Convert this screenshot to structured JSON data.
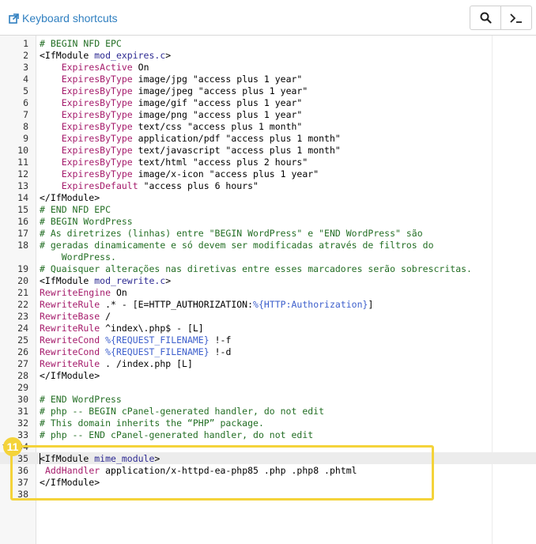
{
  "toolbar": {
    "shortcuts_label": "Keyboard shortcuts",
    "search_icon": "search-icon",
    "terminal_icon": "terminal-icon"
  },
  "editor": {
    "lines": [
      {
        "n": "1",
        "segs": [
          {
            "t": "# BEGIN NFD EPC",
            "c": "com"
          }
        ]
      },
      {
        "n": "2",
        "segs": [
          {
            "t": "<IfModule ",
            "c": ""
          },
          {
            "t": "mod_expires.c",
            "c": "tag"
          },
          {
            "t": ">",
            "c": ""
          }
        ]
      },
      {
        "n": "3",
        "segs": [
          {
            "t": "    ",
            "c": ""
          },
          {
            "t": "ExpiresActive",
            "c": "kw"
          },
          {
            "t": " On",
            "c": ""
          }
        ]
      },
      {
        "n": "4",
        "segs": [
          {
            "t": "    ",
            "c": ""
          },
          {
            "t": "ExpiresByType",
            "c": "kw"
          },
          {
            "t": " image/jpg \"access plus 1 year\"",
            "c": ""
          }
        ]
      },
      {
        "n": "5",
        "segs": [
          {
            "t": "    ",
            "c": ""
          },
          {
            "t": "ExpiresByType",
            "c": "kw"
          },
          {
            "t": " image/jpeg \"access plus 1 year\"",
            "c": ""
          }
        ]
      },
      {
        "n": "6",
        "segs": [
          {
            "t": "    ",
            "c": ""
          },
          {
            "t": "ExpiresByType",
            "c": "kw"
          },
          {
            "t": " image/gif \"access plus 1 year\"",
            "c": ""
          }
        ]
      },
      {
        "n": "7",
        "segs": [
          {
            "t": "    ",
            "c": ""
          },
          {
            "t": "ExpiresByType",
            "c": "kw"
          },
          {
            "t": " image/png \"access plus 1 year\"",
            "c": ""
          }
        ]
      },
      {
        "n": "8",
        "segs": [
          {
            "t": "    ",
            "c": ""
          },
          {
            "t": "ExpiresByType",
            "c": "kw"
          },
          {
            "t": " text/css \"access plus 1 month\"",
            "c": ""
          }
        ]
      },
      {
        "n": "9",
        "segs": [
          {
            "t": "    ",
            "c": ""
          },
          {
            "t": "ExpiresByType",
            "c": "kw"
          },
          {
            "t": " application/pdf \"access plus 1 month\"",
            "c": ""
          }
        ]
      },
      {
        "n": "10",
        "segs": [
          {
            "t": "    ",
            "c": ""
          },
          {
            "t": "ExpiresByType",
            "c": "kw"
          },
          {
            "t": " text/javascript \"access plus 1 month\"",
            "c": ""
          }
        ]
      },
      {
        "n": "11",
        "segs": [
          {
            "t": "    ",
            "c": ""
          },
          {
            "t": "ExpiresByType",
            "c": "kw"
          },
          {
            "t": " text/html \"access plus 2 hours\"",
            "c": ""
          }
        ]
      },
      {
        "n": "12",
        "segs": [
          {
            "t": "    ",
            "c": ""
          },
          {
            "t": "ExpiresByType",
            "c": "kw"
          },
          {
            "t": " image/x-icon \"access plus 1 year\"",
            "c": ""
          }
        ]
      },
      {
        "n": "13",
        "segs": [
          {
            "t": "    ",
            "c": ""
          },
          {
            "t": "ExpiresDefault",
            "c": "kw"
          },
          {
            "t": " \"access plus 6 hours\"",
            "c": ""
          }
        ]
      },
      {
        "n": "14",
        "segs": [
          {
            "t": "</IfModule>",
            "c": ""
          }
        ]
      },
      {
        "n": "15",
        "segs": [
          {
            "t": "# END NFD EPC",
            "c": "com"
          }
        ]
      },
      {
        "n": "16",
        "segs": [
          {
            "t": "# BEGIN WordPress",
            "c": "com"
          }
        ]
      },
      {
        "n": "17",
        "segs": [
          {
            "t": "# As diretrizes (linhas) entre \"BEGIN WordPress\" e \"END WordPress\" são",
            "c": "com"
          }
        ]
      },
      {
        "n": "18",
        "segs": [
          {
            "t": "# geradas dinamicamente e só devem ser modificadas através de filtros do",
            "c": "com"
          }
        ]
      },
      {
        "n": "",
        "segs": [
          {
            "t": "    WordPress.",
            "c": "com"
          }
        ]
      },
      {
        "n": "19",
        "segs": [
          {
            "t": "# Quaisquer alterações nas diretivas entre esses marcadores serão sobrescritas.",
            "c": "com"
          }
        ]
      },
      {
        "n": "20",
        "segs": [
          {
            "t": "<IfModule ",
            "c": ""
          },
          {
            "t": "mod_rewrite.c",
            "c": "tag"
          },
          {
            "t": ">",
            "c": ""
          }
        ]
      },
      {
        "n": "21",
        "segs": [
          {
            "t": "RewriteEngine",
            "c": "kw"
          },
          {
            "t": " On",
            "c": ""
          }
        ]
      },
      {
        "n": "22",
        "segs": [
          {
            "t": "RewriteRule",
            "c": "kw"
          },
          {
            "t": " .* - [E=HTTP_AUTHORIZATION:",
            "c": ""
          },
          {
            "t": "%{HTTP:Authorization}",
            "c": "var"
          },
          {
            "t": "]",
            "c": ""
          }
        ]
      },
      {
        "n": "23",
        "segs": [
          {
            "t": "RewriteBase",
            "c": "kw"
          },
          {
            "t": " /",
            "c": ""
          }
        ]
      },
      {
        "n": "24",
        "segs": [
          {
            "t": "RewriteRule",
            "c": "kw"
          },
          {
            "t": " ^index\\.php$ - [L]",
            "c": ""
          }
        ]
      },
      {
        "n": "25",
        "segs": [
          {
            "t": "RewriteCond",
            "c": "kw"
          },
          {
            "t": " ",
            "c": ""
          },
          {
            "t": "%{REQUEST_FILENAME}",
            "c": "var"
          },
          {
            "t": " !-f",
            "c": ""
          }
        ]
      },
      {
        "n": "26",
        "segs": [
          {
            "t": "RewriteCond",
            "c": "kw"
          },
          {
            "t": " ",
            "c": ""
          },
          {
            "t": "%{REQUEST_FILENAME}",
            "c": "var"
          },
          {
            "t": " !-d",
            "c": ""
          }
        ]
      },
      {
        "n": "27",
        "segs": [
          {
            "t": "RewriteRule",
            "c": "kw"
          },
          {
            "t": " . /index.php [L]",
            "c": ""
          }
        ]
      },
      {
        "n": "28",
        "segs": [
          {
            "t": "</IfModule>",
            "c": ""
          }
        ]
      },
      {
        "n": "29",
        "segs": [
          {
            "t": "",
            "c": ""
          }
        ]
      },
      {
        "n": "30",
        "segs": [
          {
            "t": "# END WordPress",
            "c": "com"
          }
        ]
      },
      {
        "n": "31",
        "segs": [
          {
            "t": "# php -- BEGIN cPanel-generated handler, do not edit",
            "c": "com"
          }
        ]
      },
      {
        "n": "32",
        "segs": [
          {
            "t": "# This domain inherits the “PHP” package.",
            "c": "com"
          }
        ]
      },
      {
        "n": "33",
        "segs": [
          {
            "t": "# php -- END cPanel-generated handler, do not edit",
            "c": "com"
          }
        ]
      },
      {
        "n": "34",
        "segs": [
          {
            "t": "",
            "c": ""
          }
        ]
      },
      {
        "n": "35",
        "segs": [
          {
            "t": "<IfModule ",
            "c": ""
          },
          {
            "t": "mime_module",
            "c": "tag"
          },
          {
            "t": ">",
            "c": ""
          }
        ]
      },
      {
        "n": "36",
        "segs": [
          {
            "t": " ",
            "c": ""
          },
          {
            "t": "AddHandler",
            "c": "kw"
          },
          {
            "t": " application/x-httpd-ea-php85 .php .php8 .phtml",
            "c": ""
          }
        ]
      },
      {
        "n": "37",
        "segs": [
          {
            "t": "</IfModule>",
            "c": ""
          }
        ]
      },
      {
        "n": "38",
        "segs": [
          {
            "t": "",
            "c": ""
          }
        ]
      }
    ]
  },
  "callout": {
    "number": "11",
    "color": "#f4d33a"
  }
}
